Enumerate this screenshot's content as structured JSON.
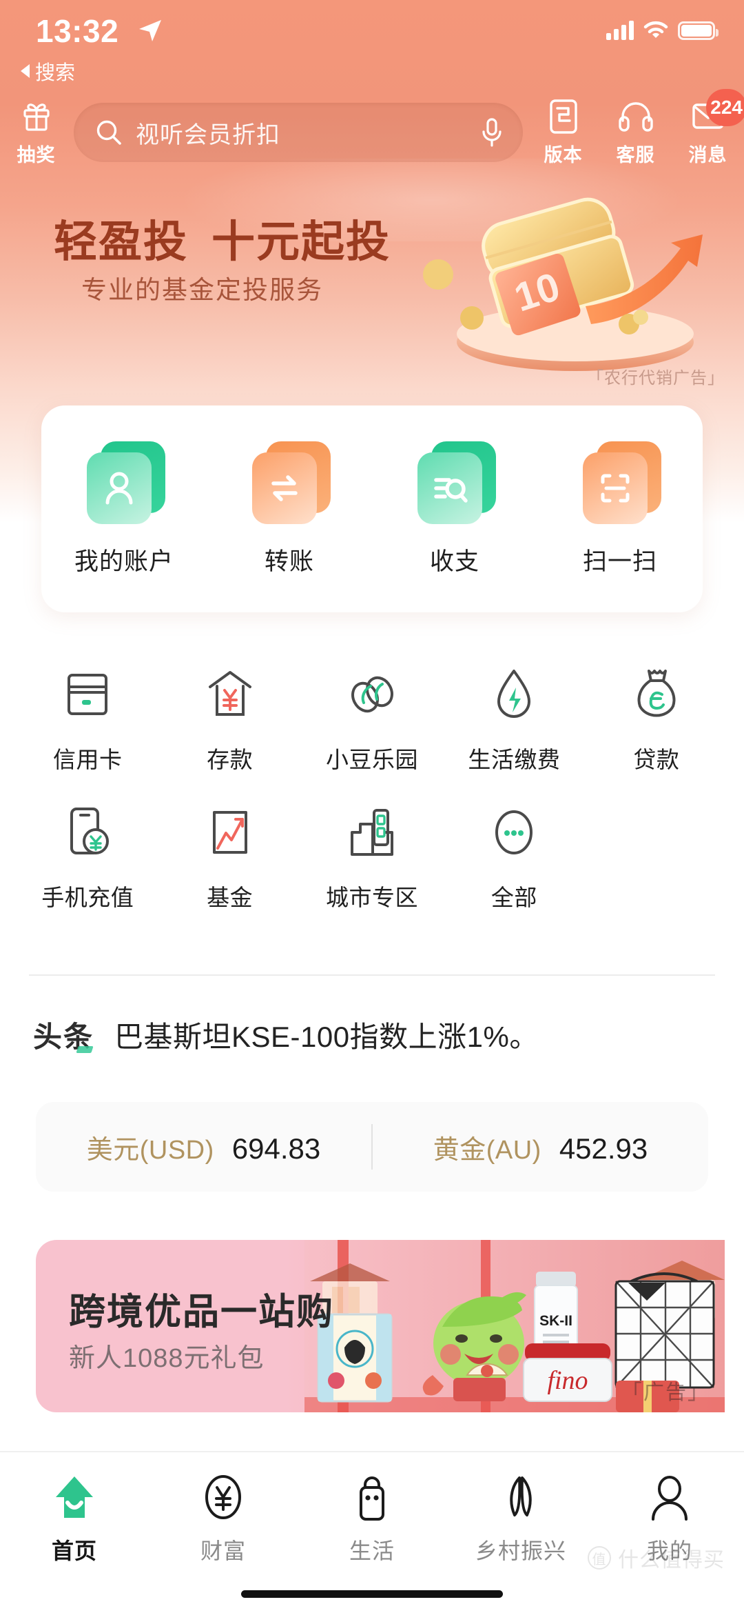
{
  "status_bar": {
    "time": "13:32",
    "location_icon": "location-arrow-icon",
    "signal_icon": "cellular-signal-icon",
    "wifi_icon": "wifi-icon",
    "battery_icon": "battery-icon"
  },
  "back_nav": {
    "label": "搜索",
    "icon": "back-triangle-icon"
  },
  "header": {
    "lottery": {
      "label": "抽奖",
      "icon": "gift-icon"
    },
    "search": {
      "placeholder": "视听会员折扣",
      "search_icon": "search-icon",
      "mic_icon": "microphone-icon"
    },
    "version": {
      "label": "版本",
      "icon": "version-doc-icon"
    },
    "service": {
      "label": "客服",
      "icon": "headset-icon"
    },
    "messages": {
      "label": "消息",
      "icon": "envelope-icon",
      "badge": "224"
    }
  },
  "hero": {
    "title_part1": "轻盈投",
    "title_part2": "十元起投",
    "subtitle": "专业的基金定投服务",
    "ad_label": "「农行代销广告」",
    "art": "treasure-chest-illustration"
  },
  "quick_actions": [
    {
      "label": "我的账户",
      "icon": "account-person-icon",
      "color": "green"
    },
    {
      "label": "转账",
      "icon": "transfer-arrows-icon",
      "color": "orange"
    },
    {
      "label": "收支",
      "icon": "income-expense-search-icon",
      "color": "green"
    },
    {
      "label": "扫一扫",
      "icon": "qr-scan-icon",
      "color": "orange"
    }
  ],
  "services": {
    "row1": [
      {
        "label": "信用卡",
        "icon": "credit-card-icon"
      },
      {
        "label": "存款",
        "icon": "deposit-house-yen-icon"
      },
      {
        "label": "小豆乐园",
        "icon": "beans-icon"
      },
      {
        "label": "生活缴费",
        "icon": "utility-droplet-bolt-icon"
      },
      {
        "label": "贷款",
        "icon": "loan-moneybag-e-icon"
      }
    ],
    "row2": [
      {
        "label": "手机充值",
        "icon": "phone-topup-icon"
      },
      {
        "label": "基金",
        "icon": "fund-chart-icon"
      },
      {
        "label": "城市专区",
        "icon": "city-buildings-icon"
      },
      {
        "label": "全部",
        "icon": "more-dots-icon"
      }
    ]
  },
  "headline": {
    "tag": "头条",
    "text": "巴基斯坦KSE-100指数上涨1%。"
  },
  "rates": [
    {
      "name": "美元(USD)",
      "value": "694.83"
    },
    {
      "name": "黄金(AU)",
      "value": "452.93"
    }
  ],
  "promo": {
    "title": "跨境优品一站购",
    "subtitle": "新人1088元礼包",
    "ad_label": "「广告」",
    "art": "cross-border-products-illustration"
  },
  "tabs": [
    {
      "label": "首页",
      "icon": "home-icon",
      "active": true
    },
    {
      "label": "财富",
      "icon": "wealth-yen-icon",
      "active": false
    },
    {
      "label": "生活",
      "icon": "life-bag-icon",
      "active": false
    },
    {
      "label": "乡村振兴",
      "icon": "rural-leaf-icon",
      "active": false
    },
    {
      "label": "我的",
      "icon": "profile-person-icon",
      "active": false
    }
  ],
  "watermark": {
    "text": "什么值得买",
    "mark": "值"
  },
  "colors": {
    "header_orange": "#f4977a",
    "brand_green": "#2ec48d",
    "accent_orange": "#f79351",
    "badge_red": "#f4614f",
    "gold": "#b0935f",
    "promo_pink": "#f8c2ce",
    "hero_title": "#9a3b20"
  }
}
